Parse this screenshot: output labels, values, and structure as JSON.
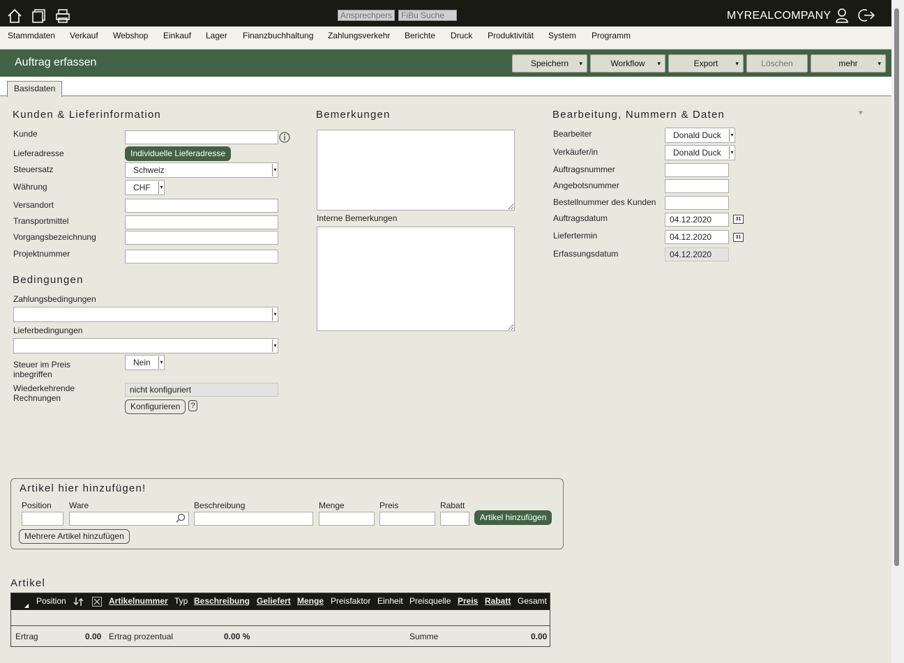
{
  "topbar": {
    "search_contact_placeholder": "Ansprechpersoi",
    "search_fibu_placeholder": "FiBu Suche",
    "company": "MYREALCOMPANY"
  },
  "menu": [
    "Stammdaten",
    "Verkauf",
    "Webshop",
    "Einkauf",
    "Lager",
    "Finanzbuchhaltung",
    "Zahlungsverkehr",
    "Berichte",
    "Druck",
    "Produktivität",
    "System",
    "Programm"
  ],
  "header": {
    "title": "Auftrag erfassen",
    "buttons": {
      "speichern": "Speichern",
      "workflow": "Workflow",
      "export": "Export",
      "loeschen": "Löschen",
      "mehr": "mehr"
    }
  },
  "tabs": {
    "basisdaten": "Basisdaten"
  },
  "kunden": {
    "heading": "Kunden & Lieferinformation",
    "kunde_label": "Kunde",
    "kunde_value": "",
    "lieferadresse_label": "Lieferadresse",
    "lieferadresse_button": "Individuelle Lieferadresse",
    "steuersatz_label": "Steuersatz",
    "steuersatz_value": "Schweiz",
    "waehrung_label": "Währung",
    "waehrung_value": "CHF",
    "versandort_label": "Versandort",
    "transportmittel_label": "Transportmittel",
    "vorgangsbezeichnung_label": "Vorgangsbezeichnung",
    "projektnummer_label": "Projektnummer"
  },
  "bedingungen": {
    "heading": "Bedingungen",
    "zahlungsbedingungen_label": "Zahlungsbedingungen",
    "lieferbedingungen_label": "Lieferbedingungen",
    "steuer_label": "Steuer im Preis inbegriffen",
    "steuer_value": "Nein",
    "wiederkehrend_label": "Wiederkehrende Rechnungen",
    "wiederkehrend_value": "nicht konfiguriert",
    "konfigurieren_button": "Konfigurieren",
    "help": "?"
  },
  "bemerkungen": {
    "heading": "Bemerkungen",
    "intern_label": "Interne Bemerkungen"
  },
  "bearbeitung": {
    "heading": "Bearbeitung, Nummern & Daten",
    "bearbeiter_label": "Bearbeiter",
    "bearbeiter_value": "Donald Duck",
    "verkaeufer_label": "Verkäufer/in",
    "verkaeufer_value": "Donald Duck",
    "auftragsnummer_label": "Auftragsnummer",
    "angebotsnummer_label": "Angebotsnummer",
    "bestellnummer_label": "Bestellnummer des Kunden",
    "auftragsdatum_label": "Auftragsdatum",
    "auftragsdatum_value": "04.12.2020",
    "liefertermin_label": "Liefertermin",
    "liefertermin_value": "04.12.2020",
    "erfassungsdatum_label": "Erfassungsdatum",
    "erfassungsdatum_value": "04.12.2020",
    "cal_glyph": "31"
  },
  "artikel_add": {
    "heading": "Artikel hier hinzufügen!",
    "position_label": "Position",
    "ware_label": "Ware",
    "beschreibung_label": "Beschreibung",
    "menge_label": "Menge",
    "preis_label": "Preis",
    "rabatt_label": "Rabatt",
    "add_button": "Artikel hinzufügen",
    "multi_button": "Mehrere Artikel hinzufügen"
  },
  "artikel_table": {
    "heading": "Artikel",
    "columns": {
      "position": "Position",
      "artikelnummer": "Artikelnummer",
      "typ": "Typ",
      "beschreibung": "Beschreibung",
      "geliefert": "Geliefert",
      "menge": "Menge",
      "preisfaktor": "Preisfaktor",
      "einheit": "Einheit",
      "preisquelle": "Preisquelle",
      "preis": "Preis",
      "rabatt": "Rabatt",
      "gesamt": "Gesamt"
    },
    "footer": {
      "ertrag_label": "Ertrag",
      "ertrag_value": "0.00",
      "ertrag_prozent_label": "Ertrag prozentual",
      "ertrag_prozent_value": "0.00 %",
      "summe_label": "Summe",
      "summe_value": "0.00"
    }
  },
  "colors": {
    "brand_green": "#416244",
    "dark": "#1a1a14",
    "page_bg": "#e9e8df"
  }
}
